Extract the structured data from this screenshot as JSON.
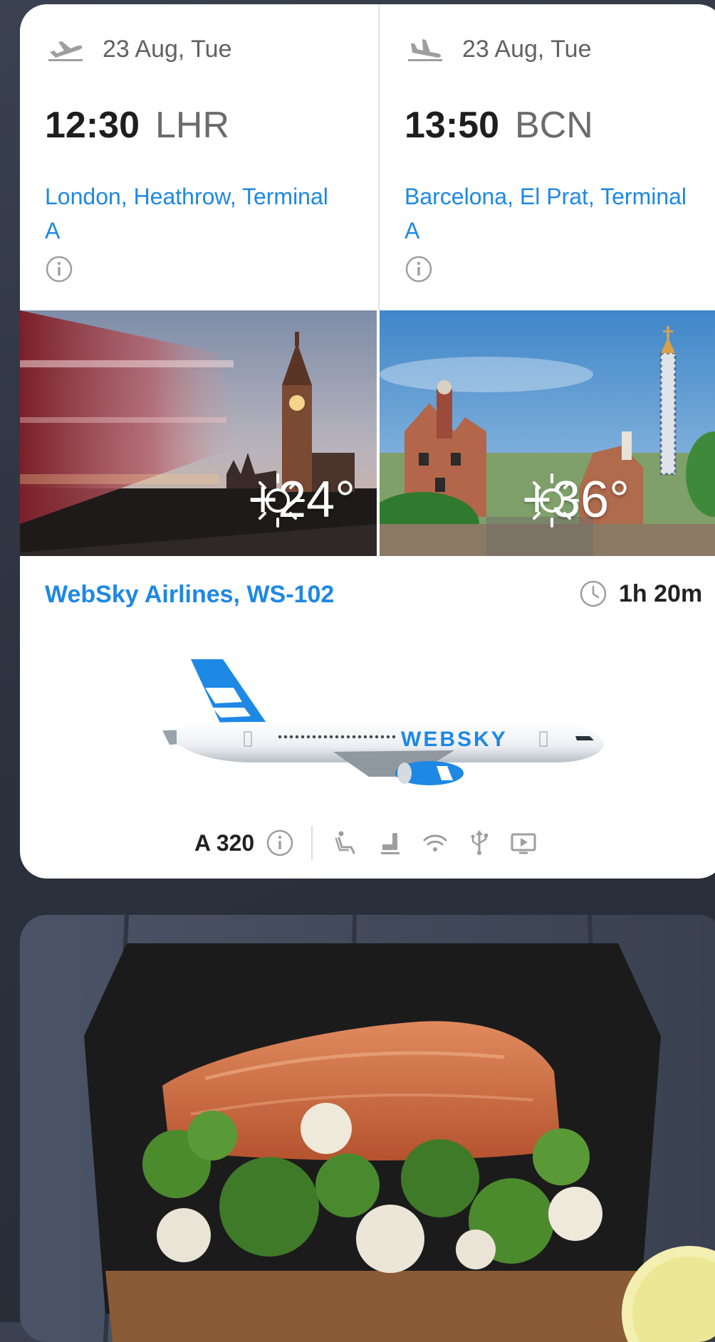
{
  "departure": {
    "date": "23 Aug, Tue",
    "time": "12:30",
    "code": "LHR",
    "airport": "London, Heathrow, Terminal A",
    "temperature": "+24°"
  },
  "arrival": {
    "date": "23 Aug, Tue",
    "time": "13:50",
    "code": "BCN",
    "airport": "Barcelona, El Prat, Terminal A",
    "temperature": "+36°"
  },
  "flight": {
    "airline": "WebSky Airlines, WS-102",
    "duration": "1h 20m",
    "aircraft": "A 320",
    "livery_text": "WEBSKY",
    "amenities": [
      "seat-recline-icon",
      "legroom-icon",
      "wifi-icon",
      "usb-icon",
      "entertainment-icon"
    ]
  },
  "colors": {
    "accent": "#1e88e5",
    "card": "#ffffff",
    "background": "#2c323e"
  }
}
